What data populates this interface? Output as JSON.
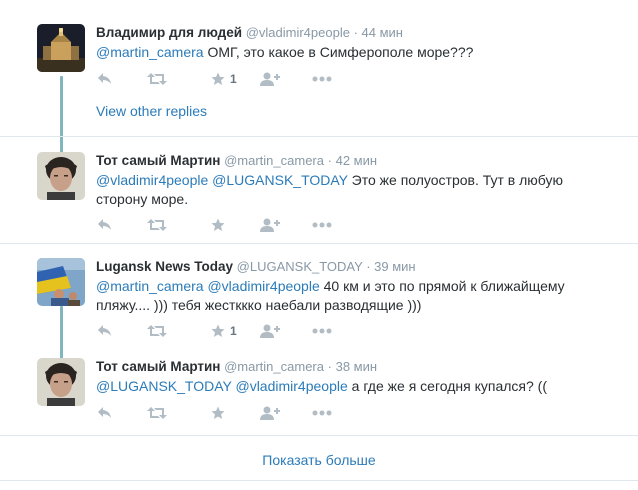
{
  "tweets": [
    {
      "fullname": "Владимир для людей",
      "username": "@vladimir4people",
      "time": "44 мин",
      "text_parts": [
        {
          "text": "@martin_camera",
          "mention": true
        },
        {
          "text": " ОМГ, это какое в Симферополе море???",
          "mention": false
        }
      ],
      "retweet_count": "1"
    },
    {
      "fullname": "Тот самый Мартин",
      "username": "@martin_camera",
      "time": "42 мин",
      "text_parts": [
        {
          "text": "@vladimir4people",
          "mention": true
        },
        {
          "text": " ",
          "mention": false
        },
        {
          "text": "@LUGANSK_TODAY",
          "mention": true
        },
        {
          "text": " Это же полуостров. Тут в любую сторону море.",
          "mention": false
        }
      ],
      "retweet_count": ""
    },
    {
      "fullname": "Lugansk News Today",
      "username": "@LUGANSK_TODAY",
      "time": "39 мин",
      "text_parts": [
        {
          "text": "@martin_camera",
          "mention": true
        },
        {
          "text": " ",
          "mention": false
        },
        {
          "text": "@vladimir4people",
          "mention": true
        },
        {
          "text": " 40 км и это по прямой к ближайщему пляжу.... ))) тебя жестккко наебали разводящие )))",
          "mention": false
        }
      ],
      "retweet_count": "1"
    },
    {
      "fullname": "Тот самый Мартин",
      "username": "@martin_camera",
      "time": "38 мин",
      "text_parts": [
        {
          "text": "@LUGANSK_TODAY",
          "mention": true
        },
        {
          "text": " ",
          "mention": false
        },
        {
          "text": "@vladimir4people",
          "mention": true
        },
        {
          "text": " а где же я сегодня купался? ((",
          "mention": false
        }
      ],
      "retweet_count": ""
    }
  ],
  "view_other_replies": "View other replies",
  "show_more": "Показать больше",
  "separator_dot": "·",
  "colors": {
    "link": "#2b7bb9",
    "timeline_line": "#7fb6bf",
    "action_icon": "#b2bcc4",
    "meta": "#8899a6"
  },
  "icons": [
    "reply-icon",
    "retweet-icon",
    "favorite-icon",
    "follow-icon",
    "more-icon"
  ]
}
